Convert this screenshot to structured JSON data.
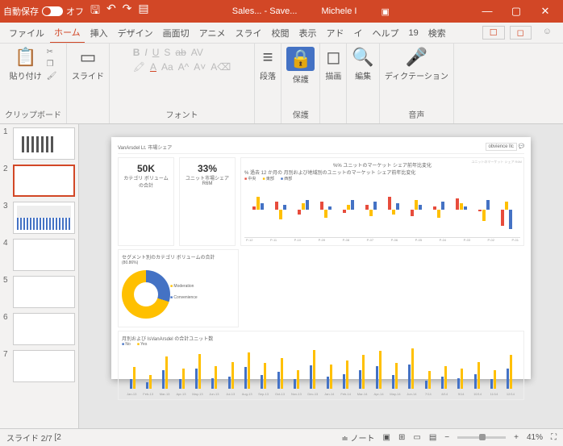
{
  "titlebar": {
    "autosave_label": "自動保存",
    "autosave_state": "オフ",
    "doc_title": "Sales... - Save...",
    "user": "Michele I"
  },
  "tabs": {
    "items": [
      "ファイル",
      "ホーム",
      "挿入",
      "デザイン",
      "画面切",
      "アニメ",
      "スライ",
      "校閲",
      "表示",
      "アド",
      "イ",
      "ヘルプ",
      "19",
      "検索"
    ],
    "active_index": 1
  },
  "ribbon": {
    "clipboard": {
      "paste": "貼り付け",
      "label": "クリップボード"
    },
    "slides": {
      "btn": "スライド",
      "label": ""
    },
    "font": {
      "label": "フォント"
    },
    "paragraph": {
      "btn": "段落",
      "label": ""
    },
    "protect": {
      "btn": "保護",
      "label": "保護"
    },
    "drawing": {
      "btn": "描画",
      "label": ""
    },
    "editing": {
      "btn": "編集",
      "label": ""
    },
    "dictation": {
      "btn": "ディクテーション",
      "label": "音声"
    }
  },
  "thumbs": {
    "count": 7,
    "active": 2
  },
  "slide": {
    "title": "VanArsdel Lt. 市場シェア",
    "obvience": "obvience llc",
    "kpi1": {
      "value": "50K",
      "label": "カテゴリ ボリュームの合計"
    },
    "kpi2": {
      "value": "33%",
      "label": "ユニット市場シェア R6M"
    },
    "chart1": {
      "title": "%% ユニットのマーケット シェア前年比変化",
      "subtitle": "% 過去 12 か月の 月別および地域別のユニットのマーケット シェア前年比変化",
      "legend": [
        "中央",
        "東部",
        "西部"
      ],
      "side_label": "ユニットのマーケット シェア R6M"
    },
    "segment": {
      "title": "セグメント別のカテゴリ ボリュームの合計",
      "pct": "(80.86%)",
      "legend": [
        "Moderation",
        "Convenience"
      ]
    },
    "chart2": {
      "title": "月別および IsVanArsdel の合計ユニット数",
      "legend": [
        "No",
        "Yes"
      ]
    }
  },
  "status": {
    "slide": "スライド 2/7",
    "lang": "[2",
    "notes": "ノート",
    "zoom": "41%"
  },
  "chart_data": [
    {
      "type": "bar",
      "title": "% 過去 12 か月の 月別および地域別のユニットのマーケット シェア前年比変化",
      "categories": [
        "P-12",
        "P-11",
        "P-10",
        "P-09",
        "P-08",
        "P-07",
        "P-06",
        "P-05",
        "P-04",
        "P-03",
        "P-02",
        "P-01"
      ],
      "series": [
        {
          "name": "中央",
          "color": "#e74c3c",
          "values": [
            2,
            5,
            -3,
            5,
            -2,
            3,
            8,
            -4,
            2,
            7,
            -1,
            -10
          ]
        },
        {
          "name": "東部",
          "color": "#ffc000",
          "values": [
            8,
            -6,
            4,
            -5,
            3,
            -4,
            -3,
            6,
            -5,
            4,
            -7,
            5
          ]
        },
        {
          "name": "西部",
          "color": "#4472c4",
          "values": [
            4,
            3,
            6,
            2,
            6,
            5,
            4,
            3,
            5,
            2,
            6,
            -12
          ]
        }
      ],
      "ylim": [
        -15,
        10
      ],
      "ylabel": "%"
    },
    {
      "type": "pie",
      "title": "セグメント別のカテゴリ ボリュームの合計",
      "series": [
        {
          "name": "Moderation",
          "color": "#ffc000",
          "value": 80.86
        },
        {
          "name": "Convenience",
          "color": "#4472c4",
          "value": 19.14
        }
      ]
    },
    {
      "type": "bar",
      "title": "月別および IsVanArsdel の合計ユニット数",
      "categories": [
        "Jan-13",
        "Feb-13",
        "Mar-13",
        "Apr-13",
        "May-13",
        "Jun-13",
        "Jul-13",
        "Aug-13",
        "Sep-13",
        "Oct-13",
        "Nov-13",
        "Dec-13",
        "Jan-14",
        "Feb-14",
        "Mar-14",
        "Apr-14",
        "May-14",
        "Jun-14",
        "7/14",
        "8/14",
        "9/14",
        "10/14",
        "11/14",
        "12/14"
      ],
      "series": [
        {
          "name": "No",
          "color": "#4472c4",
          "values": [
            15,
            10,
            28,
            14,
            30,
            16,
            18,
            32,
            20,
            25,
            14,
            35,
            18,
            22,
            28,
            34,
            20,
            36,
            12,
            18,
            16,
            22,
            14,
            30
          ]
        },
        {
          "name": "Yes",
          "color": "#ffc000",
          "values": [
            32,
            20,
            48,
            30,
            52,
            34,
            40,
            54,
            38,
            46,
            28,
            58,
            36,
            42,
            50,
            56,
            38,
            60,
            26,
            34,
            30,
            40,
            28,
            50
          ]
        }
      ],
      "ylim": [
        0,
        60
      ]
    }
  ]
}
